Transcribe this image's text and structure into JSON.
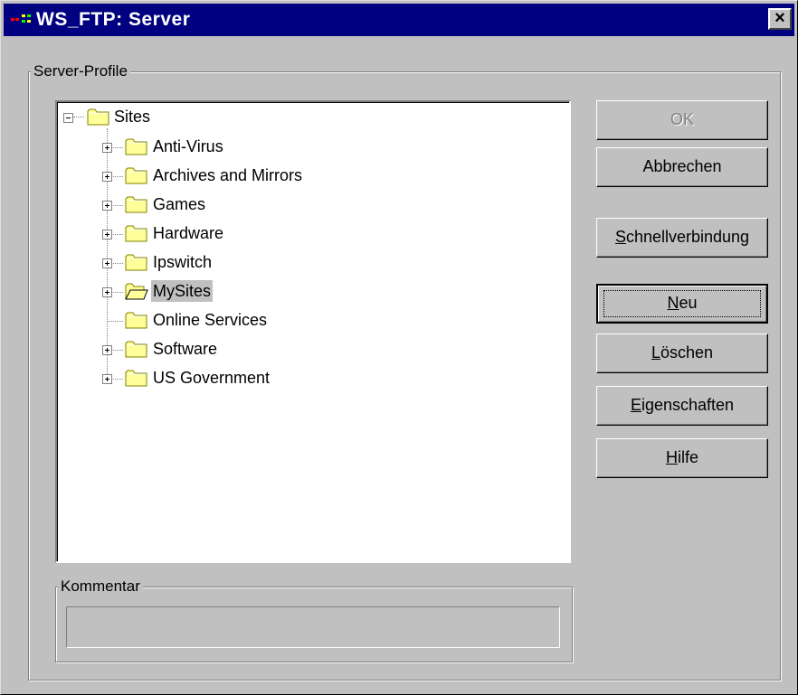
{
  "window": {
    "title": "WS_FTP: Server",
    "close_label": "×"
  },
  "server_profile": {
    "group_label": "Server-Profile"
  },
  "tree": {
    "root": "Sites",
    "items": [
      {
        "label": "Anti-Virus",
        "expandable": true,
        "open": false,
        "selected": false
      },
      {
        "label": "Archives and Mirrors",
        "expandable": true,
        "open": false,
        "selected": false
      },
      {
        "label": "Games",
        "expandable": true,
        "open": false,
        "selected": false
      },
      {
        "label": "Hardware",
        "expandable": true,
        "open": false,
        "selected": false
      },
      {
        "label": "Ipswitch",
        "expandable": true,
        "open": false,
        "selected": false
      },
      {
        "label": "MySites",
        "expandable": true,
        "open": true,
        "selected": true
      },
      {
        "label": "Online Services",
        "expandable": false,
        "open": false,
        "selected": false
      },
      {
        "label": "Software",
        "expandable": true,
        "open": false,
        "selected": false
      },
      {
        "label": "US Government",
        "expandable": true,
        "open": false,
        "selected": false
      }
    ]
  },
  "buttons": {
    "ok": "OK",
    "cancel": "Abbrechen",
    "quick_connect": {
      "mnemonic": "S",
      "rest": "chnellverbindung"
    },
    "new": {
      "mnemonic": "N",
      "rest": "eu"
    },
    "delete": {
      "mnemonic": "L",
      "rest": "öschen"
    },
    "properties": {
      "mnemonic": "E",
      "rest": "igenschaften"
    },
    "help": {
      "mnemonic": "H",
      "rest": "ilfe"
    }
  },
  "comment": {
    "group_label": "Kommentar",
    "value": ""
  },
  "colors": {
    "titlebar": "#000080",
    "face": "#c0c0c0",
    "folder": "#ffff99"
  }
}
